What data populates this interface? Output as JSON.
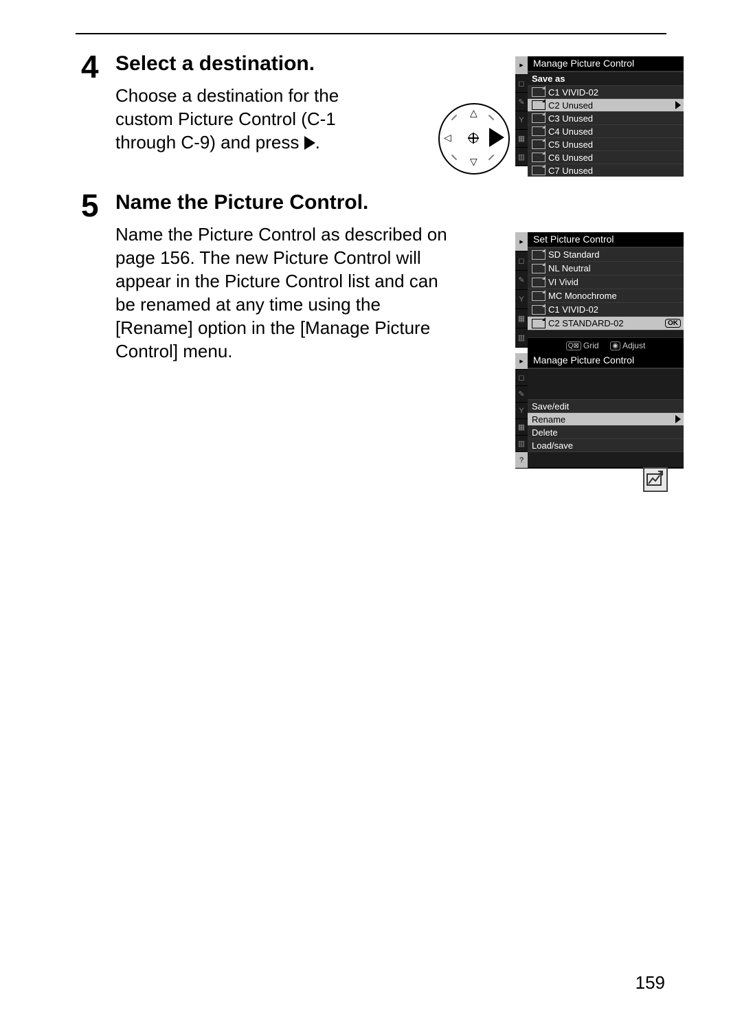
{
  "page_number": "159",
  "steps": {
    "s4": {
      "num": "4",
      "heading": "Select a destination.",
      "body_pre": "Choose a destination for the custom Picture Control (C-1 through C-9) and press ",
      "body_post": "."
    },
    "s5": {
      "num": "5",
      "heading": "Name the Picture Control.",
      "body": "Name the Picture Control as described on page 156.  The new Picture Control will appear in the Picture Control list and can be renamed at any time using the [Rename] option in the [Manage Picture Control] menu."
    }
  },
  "lcd1": {
    "title": "Manage Picture Control",
    "sub": "Save as",
    "rows": [
      {
        "label": "C1 VIVID-02",
        "hi": false
      },
      {
        "label": "C2 Unused",
        "hi": true,
        "chev": true
      },
      {
        "label": "C3 Unused",
        "hi": false
      },
      {
        "label": "C4 Unused",
        "hi": false
      },
      {
        "label": "C5 Unused",
        "hi": false
      },
      {
        "label": "C6 Unused",
        "hi": false
      },
      {
        "label": "C7 Unused",
        "hi": false
      }
    ]
  },
  "lcd2": {
    "title": "Set Picture Control",
    "rows": [
      {
        "label": "SD Standard"
      },
      {
        "label": "NL Neutral"
      },
      {
        "label": "VI Vivid"
      },
      {
        "label": "MC Monochrome"
      },
      {
        "label": "C1 VIVID-02"
      },
      {
        "label": "C2 STANDARD-02",
        "hi": true,
        "ok": true
      }
    ],
    "footer_left": "Grid",
    "footer_right": "Adjust"
  },
  "lcd3": {
    "title": "Manage Picture Control",
    "rows": [
      {
        "label": "Save/edit"
      },
      {
        "label": "Rename",
        "hi": true,
        "chev": true
      },
      {
        "label": "Delete"
      },
      {
        "label": "Load/save"
      }
    ]
  }
}
